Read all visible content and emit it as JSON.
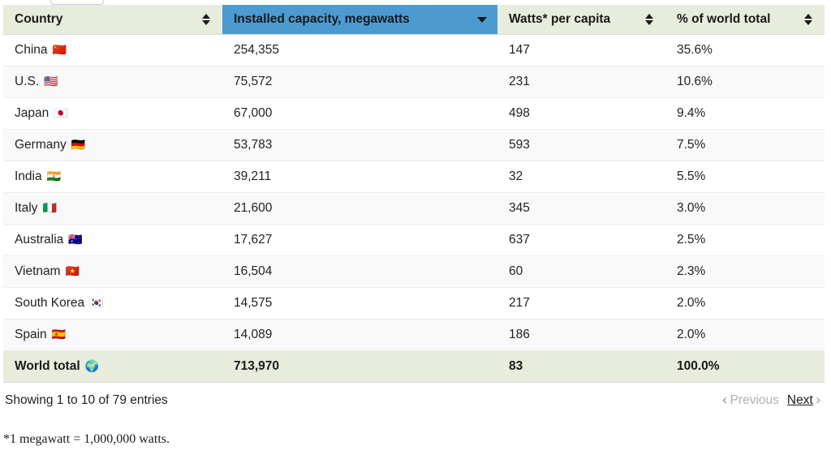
{
  "table": {
    "columns": [
      {
        "key": "country",
        "label": "Country",
        "sort": "both",
        "sorted": false
      },
      {
        "key": "capacity",
        "label": "Installed capacity, megawatts",
        "sort": "desc",
        "sorted": true
      },
      {
        "key": "watts",
        "label": "Watts* per capita",
        "sort": "both",
        "sorted": false
      },
      {
        "key": "pct",
        "label": "% of world total",
        "sort": "both",
        "sorted": false
      }
    ],
    "rows": [
      {
        "country": "China",
        "flag": "🇨🇳",
        "capacity": "254,355",
        "watts": "147",
        "pct": "35.6%"
      },
      {
        "country": "U.S.",
        "flag": "🇺🇸",
        "capacity": "75,572",
        "watts": "231",
        "pct": "10.6%"
      },
      {
        "country": "Japan",
        "flag": "🇯🇵",
        "capacity": "67,000",
        "watts": "498",
        "pct": "9.4%"
      },
      {
        "country": "Germany",
        "flag": "🇩🇪",
        "capacity": "53,783",
        "watts": "593",
        "pct": "7.5%"
      },
      {
        "country": "India",
        "flag": "🇮🇳",
        "capacity": "39,211",
        "watts": "32",
        "pct": "5.5%"
      },
      {
        "country": "Italy",
        "flag": "🇮🇹",
        "capacity": "21,600",
        "watts": "345",
        "pct": "3.0%"
      },
      {
        "country": "Australia",
        "flag": "🇦🇺",
        "capacity": "17,627",
        "watts": "637",
        "pct": "2.5%"
      },
      {
        "country": "Vietnam",
        "flag": "🇻🇳",
        "capacity": "16,504",
        "watts": "60",
        "pct": "2.3%"
      },
      {
        "country": "South Korea",
        "flag": "🇰🇷",
        "capacity": "14,575",
        "watts": "217",
        "pct": "2.0%"
      },
      {
        "country": "Spain",
        "flag": "🇪🇸",
        "capacity": "14,089",
        "watts": "186",
        "pct": "2.0%"
      }
    ],
    "total_row": {
      "country": "World total",
      "flag": "🌍",
      "capacity": "713,970",
      "watts": "83",
      "pct": "100.0%"
    }
  },
  "footer": {
    "showing": "Showing 1 to 10 of 79 entries",
    "previous_label": "Previous",
    "next_label": "Next",
    "previous_chevron": "‹",
    "next_chevron": "›"
  },
  "footnote": "*1 megawatt = 1,000,000 watts.",
  "colors": {
    "header_bg": "#e7ecdc",
    "sorted_header_bg": "#4b9bd1",
    "stripe_bg": "#f9f9f9",
    "row_bg": "#ffffff",
    "text": "#222222",
    "muted_text": "#b0b0b0"
  }
}
